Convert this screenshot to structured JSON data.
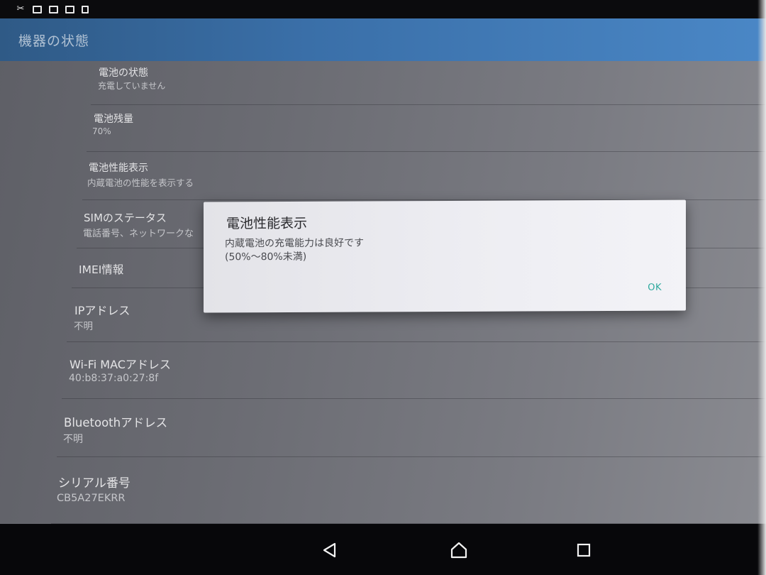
{
  "statusbar": {
    "icons": [
      "screenshot-icon",
      "sim-icon",
      "notification-icon",
      "card-icon",
      "sd-card-icon"
    ]
  },
  "appbar": {
    "title": "機器の状態"
  },
  "items": [
    {
      "title": "電池の状態",
      "sub": "充電していません"
    },
    {
      "title": "電池残量",
      "sub": "70%"
    },
    {
      "title": "電池性能表示",
      "sub": "内蔵電池の性能を表示する"
    },
    {
      "title": "SIMのステータス",
      "sub": "電話番号、ネットワークな"
    },
    {
      "title": "IMEI情報",
      "sub": ""
    },
    {
      "title": "IPアドレス",
      "sub": "不明"
    },
    {
      "title": "Wi-Fi MACアドレス",
      "sub": "40:b8:37:a0:27:8f"
    },
    {
      "title": "Bluetoothアドレス",
      "sub": "不明"
    },
    {
      "title": "シリアル番号",
      "sub": "CB5A27EKRR"
    }
  ],
  "dialog": {
    "title": "電池性能表示",
    "message_line1": "内蔵電池の充電能力は良好です",
    "message_line2": "(50%〜80%未満)",
    "ok_label": "OK"
  },
  "navbar": {
    "back": "back-icon",
    "home": "home-icon",
    "recents": "recents-icon"
  },
  "colors": {
    "accent": "#2aa89c",
    "appbar": "#3a6fa8"
  }
}
